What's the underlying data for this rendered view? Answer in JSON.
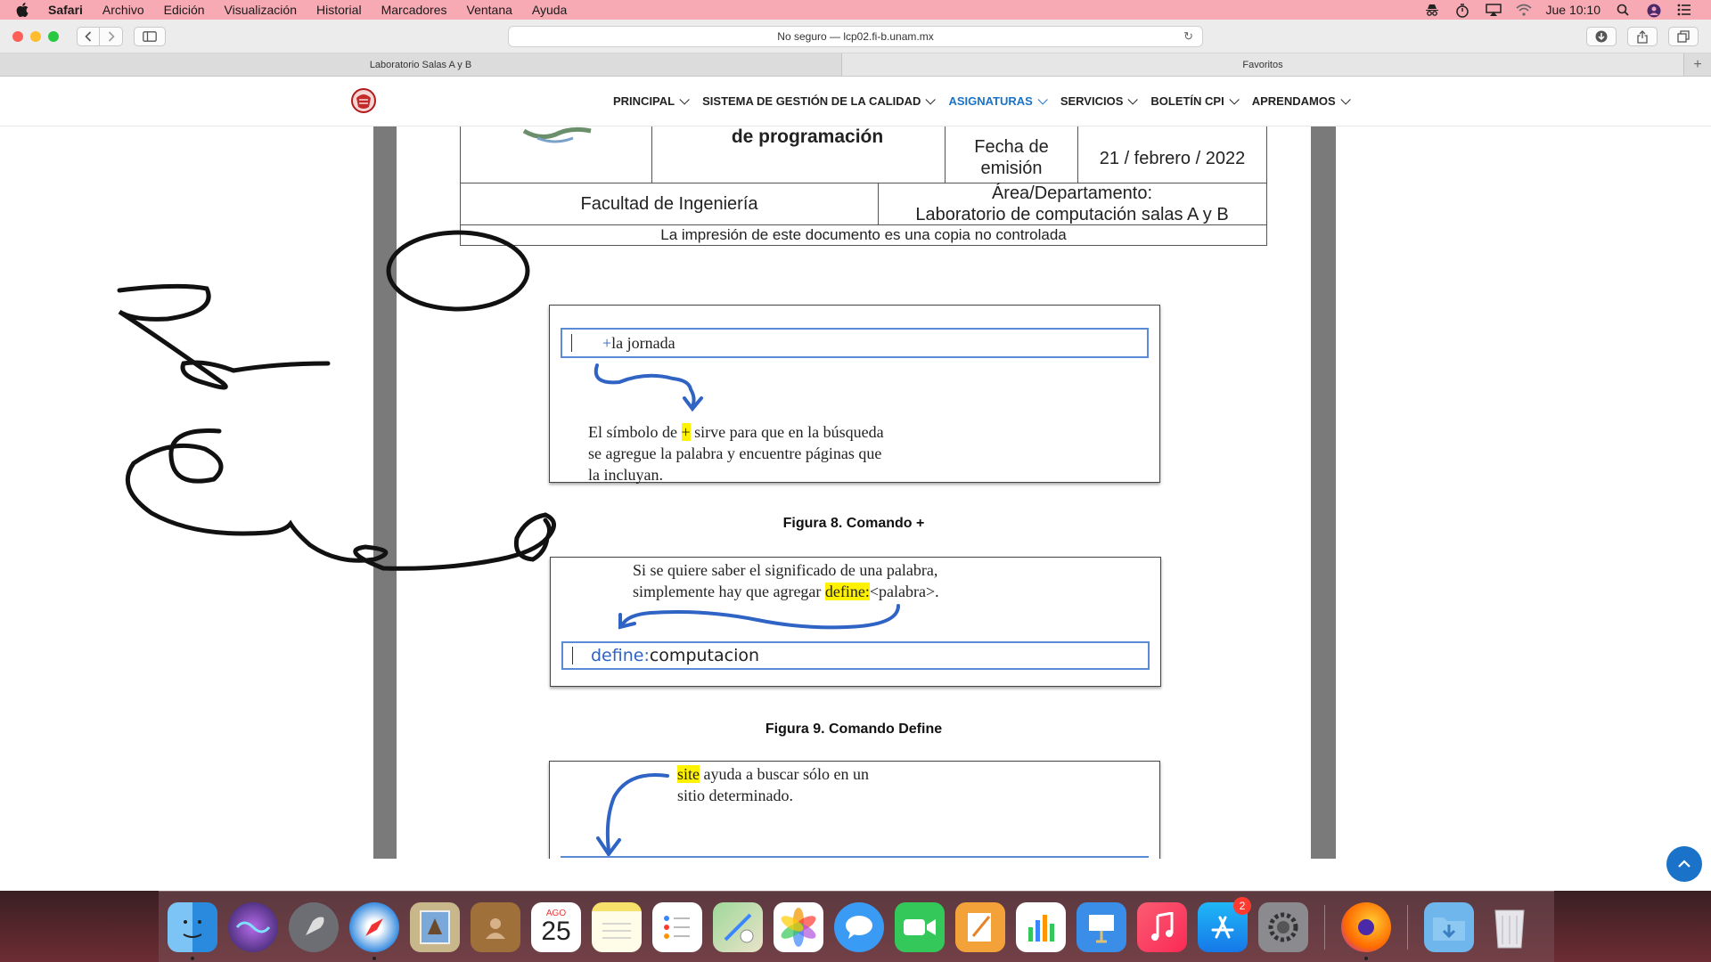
{
  "menubar": {
    "app_name": "Safari",
    "items": [
      "Archivo",
      "Edición",
      "Visualización",
      "Historial",
      "Marcadores",
      "Ventana",
      "Ayuda"
    ],
    "clock": "Jue 10:10"
  },
  "toolbar": {
    "url": "No seguro — lcp02.fi-b.unam.mx"
  },
  "tabs": {
    "tab1": "Laboratorio Salas A y B",
    "tab2": "Favoritos"
  },
  "sitenav": {
    "items": [
      {
        "label": "PRINCIPAL"
      },
      {
        "label": "SISTEMA DE GESTIÓN DE LA CALIDAD"
      },
      {
        "label": "ASIGNATURAS"
      },
      {
        "label": "SERVICIOS"
      },
      {
        "label": "BOLETÍN CPI"
      },
      {
        "label": "APRENDAMOS"
      }
    ],
    "active_color": "#1a73c8"
  },
  "document": {
    "title_fragment": "de programación",
    "fecha_label": "Fecha de emisión",
    "fecha_value": "21 / febrero / 2022",
    "facultad": "Facultad de Ingeniería",
    "area_label": "Área/Departamento:",
    "area_value": "Laboratorio de computación salas A y B",
    "copy_notice": "La impresión de este documento es una copia no controlada",
    "fig8": {
      "search_plus": "+",
      "search_text": "la jornada",
      "desc_pre": "El símbolo de ",
      "desc_hl": "+",
      "desc_post": " sirve para que en la búsqueda",
      "desc_line2": "se agregue la palabra y encuentre páginas que",
      "desc_line3": "la incluyan.",
      "caption": "Figura 8. Comando +"
    },
    "fig9": {
      "desc_line1": "Si se quiere saber el significado de una palabra,",
      "desc_line2_pre": "simplemente hay que agregar ",
      "desc_line2_hl": "define:",
      "desc_line2_post": "<palabra>.",
      "search_keyword": "define:",
      "search_text": "computacion",
      "caption": "Figura 9. Comando Define"
    },
    "fig10": {
      "desc_hl": "site",
      "desc_line1_post": " ayuda a buscar sólo en un",
      "desc_line2": "sitio determinado."
    }
  },
  "dock": {
    "calendar_month": "AGO",
    "calendar_day": "25",
    "appstore_badge": "2"
  },
  "colors": {
    "menubar": "#f7a9b4",
    "accent": "#1a73c8",
    "highlight": "#fff200",
    "annotation_blue": "#2f63c4"
  }
}
